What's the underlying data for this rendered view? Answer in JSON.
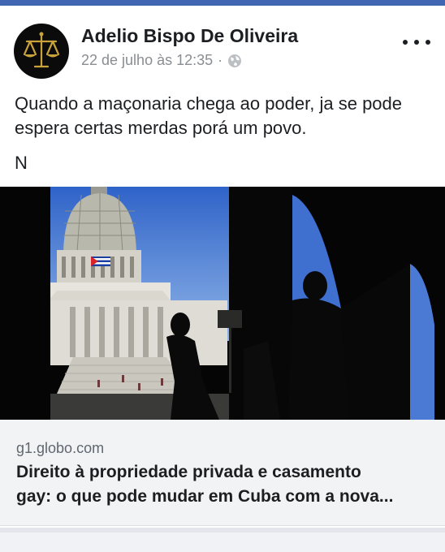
{
  "post": {
    "author": "Adelio Bispo De Oliveira",
    "timestamp": "22 de julho às 12:35",
    "separator": "·",
    "privacy_icon": "globe-icon",
    "more_icon": "more-options-icon",
    "text_line1": "Quando a maçonaria chega ao poder, ja se pode",
    "text_line2": "espera certas merdas porá um povo.",
    "text_extra": "N"
  },
  "link_preview": {
    "domain": "g1.globo.com",
    "title_line1": "Direito à propriedade privada e casamento",
    "title_line2": "gay: o que pode mudar em Cuba com a nova..."
  },
  "colors": {
    "brand_bar": "#4267b2",
    "avatar_gold": "#c9a23a",
    "link_bg": "#f2f3f5"
  }
}
